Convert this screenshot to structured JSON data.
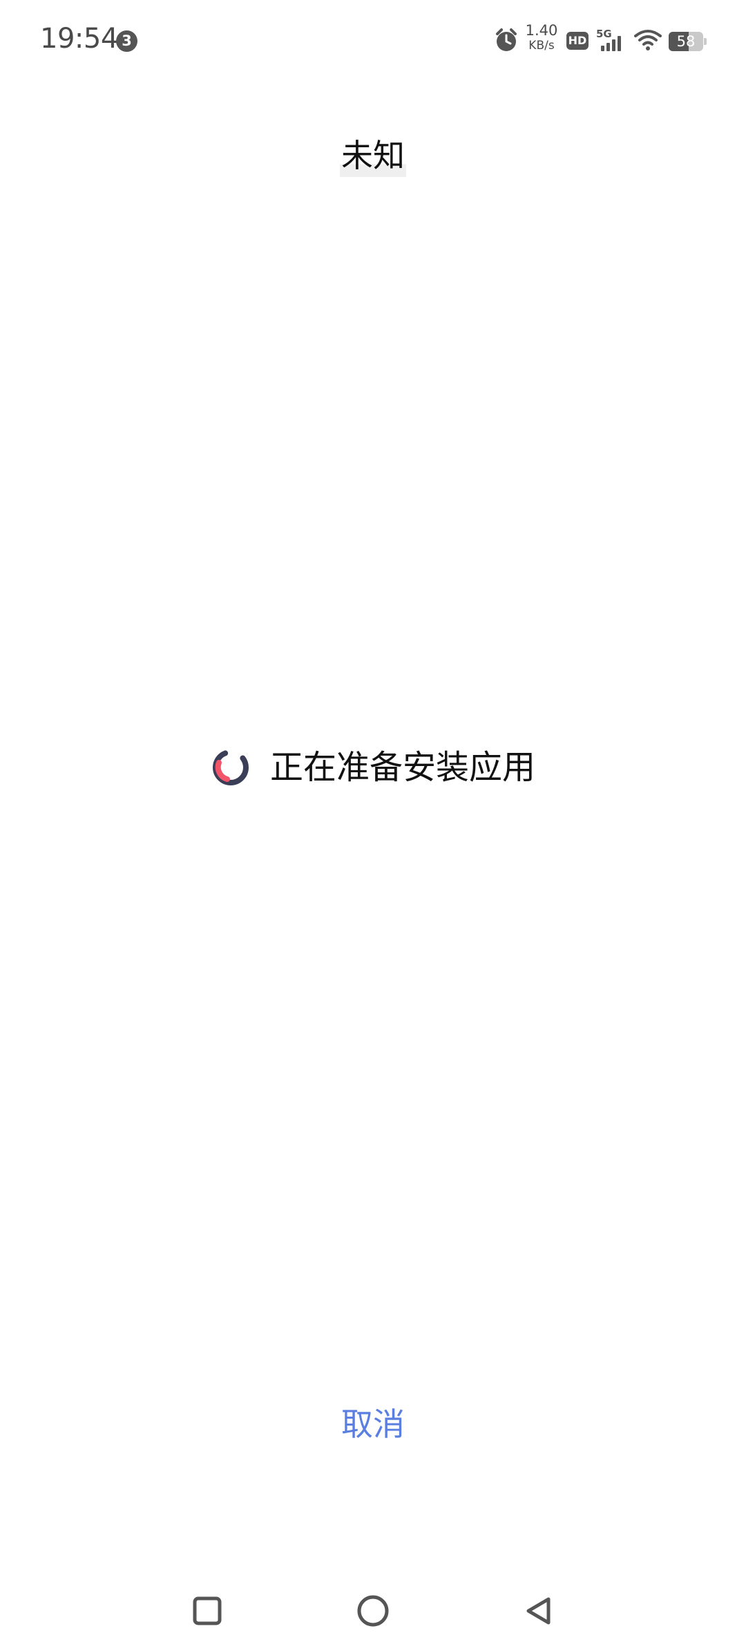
{
  "status_bar": {
    "time": "19:54",
    "notification_count": "3",
    "net_speed_value": "1.40",
    "net_speed_unit": "KB/s",
    "hd_label": "HD",
    "network_type": "5G",
    "battery_level": "58",
    "icons": [
      "alarm-icon",
      "hd-icon",
      "signal-icon",
      "wifi-icon",
      "battery-icon"
    ]
  },
  "app_title": "未知",
  "progress": {
    "text": "正在准备安装应用",
    "icon": "loading-spinner-icon",
    "colors": {
      "ring": "#3b3e57",
      "arc": "#f2546a"
    }
  },
  "cancel_label": "取消",
  "colors": {
    "accent": "#5a7fe0",
    "status_icon": "#555555"
  },
  "nav_bar": {
    "buttons": [
      "recents-icon",
      "home-icon",
      "back-icon"
    ]
  }
}
